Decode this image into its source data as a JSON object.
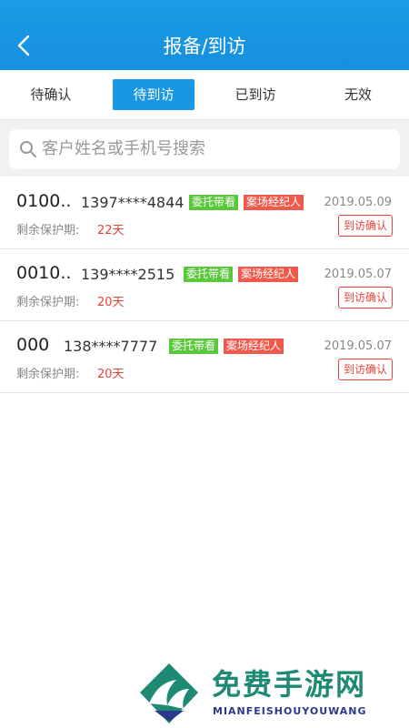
{
  "header": {
    "title": "报备/到访"
  },
  "tabs": [
    {
      "label": "待确认",
      "active": false
    },
    {
      "label": "待到访",
      "active": true
    },
    {
      "label": "已到访",
      "active": false
    },
    {
      "label": "无效",
      "active": false
    }
  ],
  "search": {
    "placeholder": "客户姓名或手机号搜索"
  },
  "records": [
    {
      "name": "0100..",
      "phone": "1397****4844",
      "tag1": "委托带看",
      "tag2": "案场经纪人",
      "date": "2019.05.09",
      "protection_label": "剩余保护期:",
      "protection_value": "22天",
      "action": "到访确认"
    },
    {
      "name": "0010..",
      "phone": "139****2515",
      "tag1": "委托带看",
      "tag2": "案场经纪人",
      "date": "2019.05.07",
      "protection_label": "剩余保护期:",
      "protection_value": "20天",
      "action": "到访确认"
    },
    {
      "name": "000",
      "phone": "138****7777",
      "tag1": "委托带看",
      "tag2": "案场经纪人",
      "date": "2019.05.07",
      "protection_label": "剩余保护期:",
      "protection_value": "20天",
      "action": "到访确认"
    }
  ],
  "watermark": {
    "title": "免费手游网",
    "subtitle": "MIANFEISHOUYOUWANG"
  },
  "colors": {
    "brand": "#1a97e2",
    "tag_green": "#59c83a",
    "tag_red": "#ef5a4c",
    "alert": "#e5433a"
  }
}
